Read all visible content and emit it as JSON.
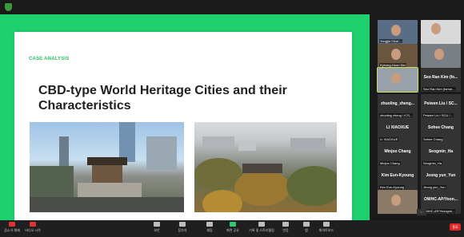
{
  "slide": {
    "kicker": "CASE ANALYSIS",
    "title": "CBD-type World Heritage Cities and their Characteristics"
  },
  "participants": [
    {
      "name": "",
      "caption": "Yongjin Choi/..."
    },
    {
      "name": "",
      "caption": ""
    },
    {
      "name": "",
      "caption": "Kyeong-Hoon Kim"
    },
    {
      "name": "",
      "caption": ""
    },
    {
      "name": "",
      "caption": ""
    },
    {
      "name": "Seo Ran Kim (fo...",
      "caption": "Seo Ran Kim (forme..."
    },
    {
      "name": "zhuoling_zheng...",
      "caption": "zhuoling zheng / ICS..."
    },
    {
      "name": "Peiwen Liu / SC...",
      "caption": "Peiwen Liu / SCU /..."
    },
    {
      "name": "LI XIAOXUE",
      "caption": "LI XIAOXUE"
    },
    {
      "name": "Sohee Chang",
      "caption": "Sohee Chang"
    },
    {
      "name": "Minjoo Chang",
      "caption": "Minjoo Chang"
    },
    {
      "name": "Seogmin_Ha",
      "caption": "Seogmin_Ha"
    },
    {
      "name": "Kim Eun-Kyoung",
      "caption": "Kim Eun-Kyoung"
    },
    {
      "name": "Jeong yun_Yun",
      "caption": "Jeong yun_Yun"
    },
    {
      "name": "",
      "caption": ""
    },
    {
      "name": "OWHC-AP/Yeon...",
      "caption": "OWHC-AP/Yeongmi..."
    }
  ],
  "toolbar": {
    "items": [
      {
        "label": "음소거 해제",
        "icon": "microphone-icon"
      },
      {
        "label": "비디오 시작",
        "icon": "video-camera-icon"
      },
      {
        "label": "보안",
        "icon": "shield-icon"
      },
      {
        "label": "참가자",
        "icon": "participants-icon"
      },
      {
        "label": "채팅",
        "icon": "chat-icon"
      },
      {
        "label": "화면 공유",
        "icon": "share-screen-icon"
      },
      {
        "label": "기록 및 스토리텔링",
        "icon": "record-icon"
      },
      {
        "label": "반응",
        "icon": "reactions-icon"
      },
      {
        "label": "앱",
        "icon": "apps-icon"
      },
      {
        "label": "화이트보드",
        "icon": "whiteboard-icon"
      }
    ],
    "end_label": "종료"
  },
  "colors": {
    "accent": "#1fd06f",
    "background": "#1a1a1a"
  }
}
